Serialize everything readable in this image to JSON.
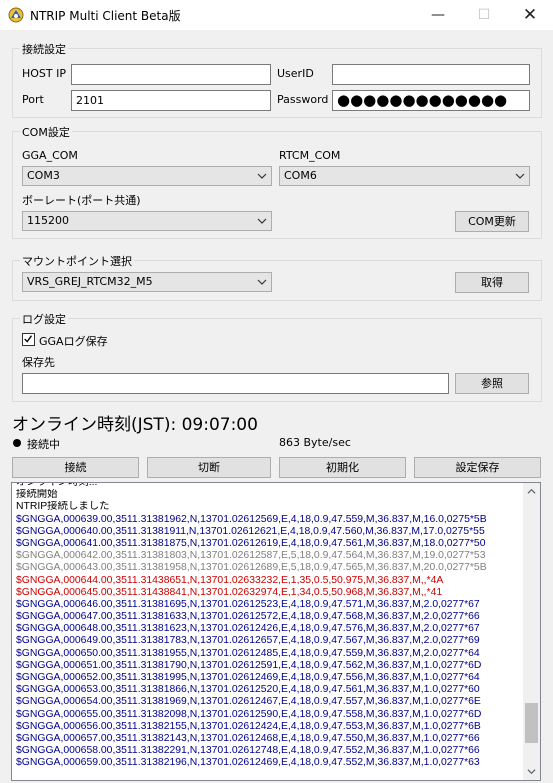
{
  "window": {
    "title": "NTRIP Multi Client Beta版"
  },
  "connection": {
    "group_label": "接続設定",
    "host_label": "HOST IP",
    "host_value": "",
    "port_label": "Port",
    "port_value": "2101",
    "user_label": "UserID",
    "user_value": "",
    "password_label": "Password",
    "password_value": "●●●●●●●●●●●●●"
  },
  "com": {
    "group_label": "COM設定",
    "gga_label": "GGA_COM",
    "gga_value": "COM3",
    "rtcm_label": "RTCM_COM",
    "rtcm_value": "COM6",
    "baud_label": "ボーレート(ポート共通)",
    "baud_value": "115200",
    "refresh_button": "COM更新"
  },
  "mount": {
    "group_label": "マウントポイント選択",
    "value": "VRS_GREJ_RTCM32_M5",
    "get_button": "取得"
  },
  "log_settings": {
    "group_label": "ログ設定",
    "gga_log_label": "GGAログ保存",
    "gga_log_checked": true,
    "save_to_label": "保存先",
    "save_path": "",
    "browse_button": "参照"
  },
  "status": {
    "online_time": "オンライン時刻(JST): 09:07:00",
    "connection_state": "接続中",
    "rate": "863 Byte/sec"
  },
  "actions": {
    "connect": "接続",
    "disconnect": "切断",
    "initialize": "初期化",
    "save_settings": "設定保存"
  },
  "colors": {
    "blue": "#00008b",
    "gray": "#808080",
    "red": "#cc0000",
    "black": "#000000"
  },
  "log_lines": [
    {
      "text": "オンライン時刻...",
      "color": "black"
    },
    {
      "text": "接続開始",
      "color": "black"
    },
    {
      "text": "NTRIP接続しました",
      "color": "black"
    },
    {
      "text": "$GNGGA,000639.00,3511.31381962,N,13701.02612569,E,4,18,0.9,47.559,M,36.837,M,16.0,0275*5B",
      "color": "blue"
    },
    {
      "text": "$GNGGA,000640.00,3511.31381911,N,13701.02612621,E,4,18,0.9,47.560,M,36.837,M,17.0,0275*55",
      "color": "blue"
    },
    {
      "text": "$GNGGA,000641.00,3511.31381875,N,13701.02612619,E,4,18,0.9,47.561,M,36.837,M,18.0,0277*50",
      "color": "blue"
    },
    {
      "text": "$GNGGA,000642.00,3511.31381803,N,13701.02612587,E,5,18,0.9,47.564,M,36.837,M,19.0,0277*53",
      "color": "gray"
    },
    {
      "text": "$GNGGA,000643.00,3511.31381958,N,13701.02612689,E,5,18,0.9,47.565,M,36.837,M,20.0,0277*5B",
      "color": "gray"
    },
    {
      "text": "$GNGGA,000644.00,3511.31438651,N,13701.02633232,E,1,35,0.5,50.975,M,36.837,M,,*4A",
      "color": "red"
    },
    {
      "text": "$GNGGA,000645.00,3511.31438841,N,13701.02632974,E,1,34,0.5,50.968,M,36.837,M,,*41",
      "color": "red"
    },
    {
      "text": "$GNGGA,000646.00,3511.31381695,N,13701.02612523,E,4,18,0.9,47.571,M,36.837,M,2.0,0277*67",
      "color": "blue"
    },
    {
      "text": "$GNGGA,000647.00,3511.31381633,N,13701.02612572,E,4,18,0.9,47.568,M,36.837,M,2.0,0277*66",
      "color": "blue"
    },
    {
      "text": "$GNGGA,000648.00,3511.31381623,N,13701.02612426,E,4,18,0.9,47.576,M,36.837,M,2.0,0277*67",
      "color": "blue"
    },
    {
      "text": "$GNGGA,000649.00,3511.31381783,N,13701.02612657,E,4,18,0.9,47.567,M,36.837,M,2.0,0277*69",
      "color": "blue"
    },
    {
      "text": "$GNGGA,000650.00,3511.31381955,N,13701.02612485,E,4,18,0.9,47.559,M,36.837,M,2.0,0277*64",
      "color": "blue"
    },
    {
      "text": "$GNGGA,000651.00,3511.31381790,N,13701.02612591,E,4,18,0.9,47.562,M,36.837,M,1.0,0277*6D",
      "color": "blue"
    },
    {
      "text": "$GNGGA,000652.00,3511.31381995,N,13701.02612469,E,4,18,0.9,47.556,M,36.837,M,1.0,0277*64",
      "color": "blue"
    },
    {
      "text": "$GNGGA,000653.00,3511.31381866,N,13701.02612520,E,4,18,0.9,47.561,M,36.837,M,1.0,0277*60",
      "color": "blue"
    },
    {
      "text": "$GNGGA,000654.00,3511.31381969,N,13701.02612467,E,4,18,0.9,47.557,M,36.837,M,1.0,0277*6E",
      "color": "blue"
    },
    {
      "text": "$GNGGA,000655.00,3511.31382098,N,13701.02612590,E,4,18,0.9,47.558,M,36.837,M,1.0,0277*6D",
      "color": "blue"
    },
    {
      "text": "$GNGGA,000656.00,3511.31382155,N,13701.02612424,E,4,18,0.9,47.553,M,36.837,M,1.0,0277*6B",
      "color": "blue"
    },
    {
      "text": "$GNGGA,000657.00,3511.31382143,N,13701.02612468,E,4,18,0.9,47.550,M,36.837,M,1.0,0277*66",
      "color": "blue"
    },
    {
      "text": "$GNGGA,000658.00,3511.31382291,N,13701.02612748,E,4,18,0.9,47.552,M,36.837,M,1.0,0277*66",
      "color": "blue"
    },
    {
      "text": "$GNGGA,000659.00,3511.31382196,N,13701.02612469,E,4,18,0.9,47.552,M,36.837,M,1.0,0277*63",
      "color": "blue"
    }
  ]
}
